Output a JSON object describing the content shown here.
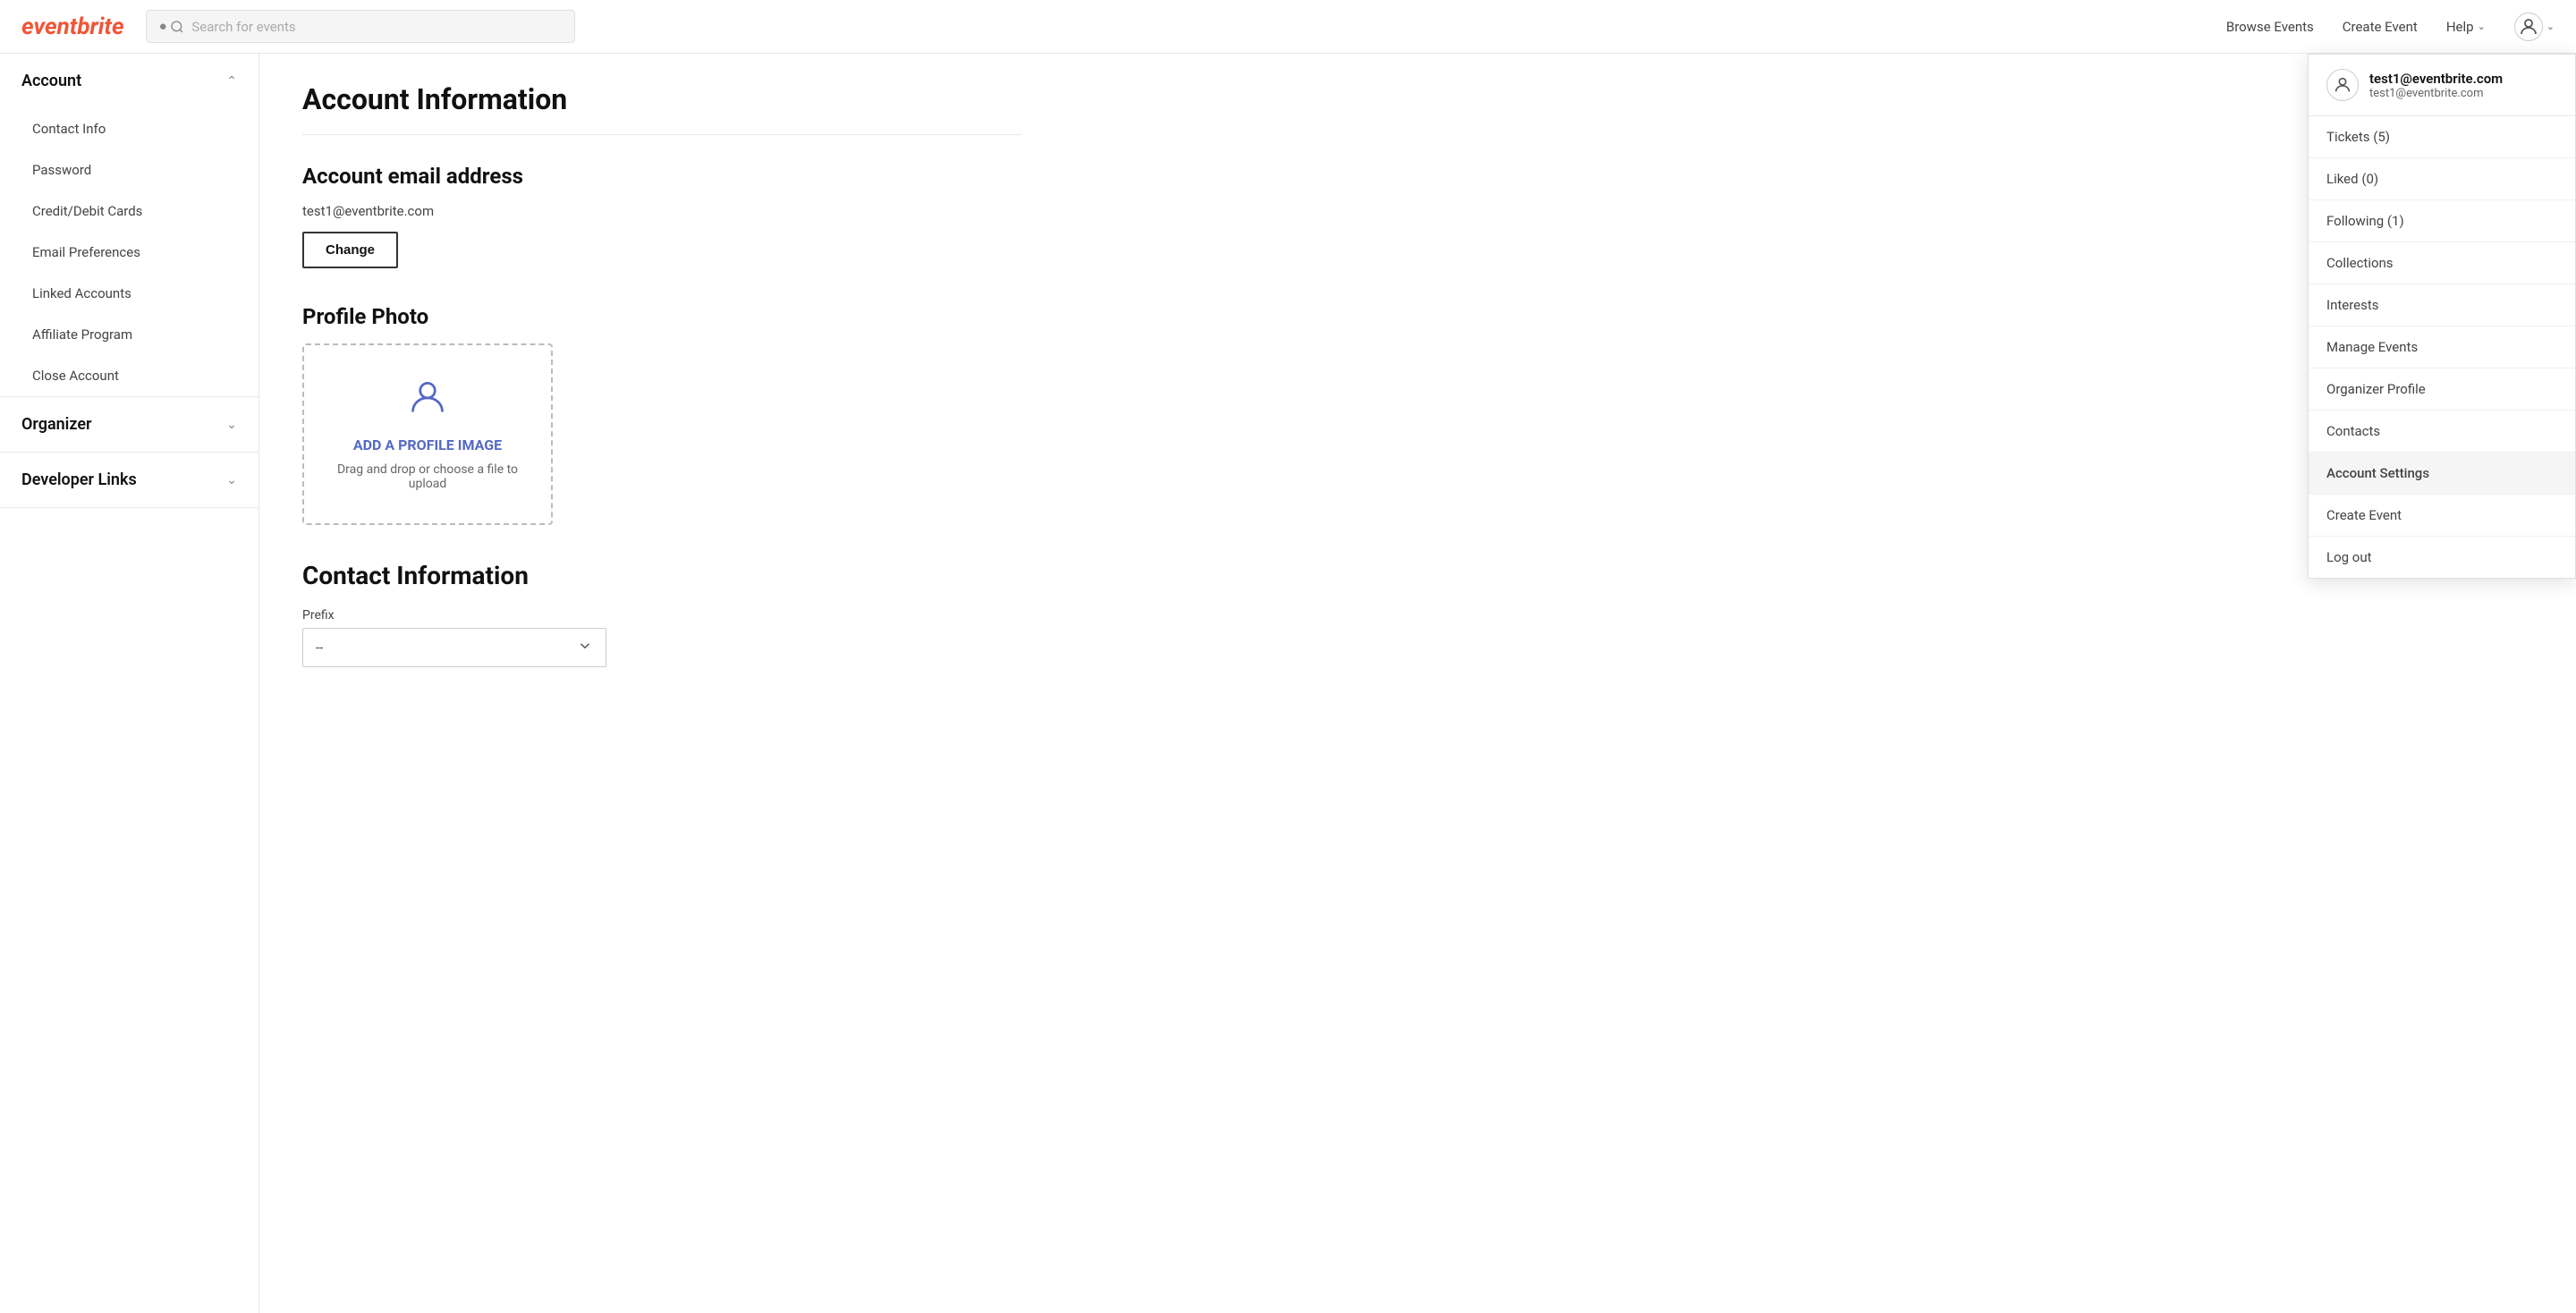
{
  "header": {
    "logo": "eventbrite",
    "search_placeholder": "Search for events",
    "nav": {
      "browse_events": "Browse Events",
      "create_event": "Create Event",
      "help": "Help"
    },
    "user_email": "test1@eventbrite.com"
  },
  "sidebar": {
    "sections": [
      {
        "id": "account",
        "title": "Account",
        "expanded": true,
        "items": [
          {
            "id": "contact-info",
            "label": "Contact Info"
          },
          {
            "id": "password",
            "label": "Password"
          },
          {
            "id": "credit-debit-cards",
            "label": "Credit/Debit Cards"
          },
          {
            "id": "email-preferences",
            "label": "Email Preferences"
          },
          {
            "id": "linked-accounts",
            "label": "Linked Accounts"
          },
          {
            "id": "affiliate-program",
            "label": "Affiliate Program"
          },
          {
            "id": "close-account",
            "label": "Close Account"
          }
        ]
      },
      {
        "id": "organizer",
        "title": "Organizer",
        "expanded": false,
        "items": []
      },
      {
        "id": "developer-links",
        "title": "Developer Links",
        "expanded": false,
        "items": []
      }
    ]
  },
  "main": {
    "page_title": "Account Information",
    "email_section": {
      "title": "Account email address",
      "email": "test1@eventbrite.com",
      "change_button": "Change"
    },
    "photo_section": {
      "title": "Profile Photo",
      "upload_label": "ADD A PROFILE IMAGE",
      "upload_hint": "Drag and drop or choose a file to upload"
    },
    "contact_section": {
      "title": "Contact Information",
      "prefix_label": "Prefix",
      "prefix_value": "--"
    }
  },
  "dropdown": {
    "user_email_primary": "test1@eventbrite.com",
    "user_email_secondary": "test1@eventbrite.com",
    "items": [
      {
        "id": "tickets",
        "label": "Tickets (5)"
      },
      {
        "id": "liked",
        "label": "Liked (0)"
      },
      {
        "id": "following",
        "label": "Following (1)"
      },
      {
        "id": "collections",
        "label": "Collections"
      },
      {
        "id": "interests",
        "label": "Interests"
      },
      {
        "id": "manage-events",
        "label": "Manage Events"
      },
      {
        "id": "organizer-profile",
        "label": "Organizer Profile"
      },
      {
        "id": "contacts",
        "label": "Contacts"
      },
      {
        "id": "account-settings",
        "label": "Account Settings",
        "active": true
      },
      {
        "id": "create-event",
        "label": "Create Event"
      },
      {
        "id": "logout",
        "label": "Log out"
      }
    ]
  }
}
